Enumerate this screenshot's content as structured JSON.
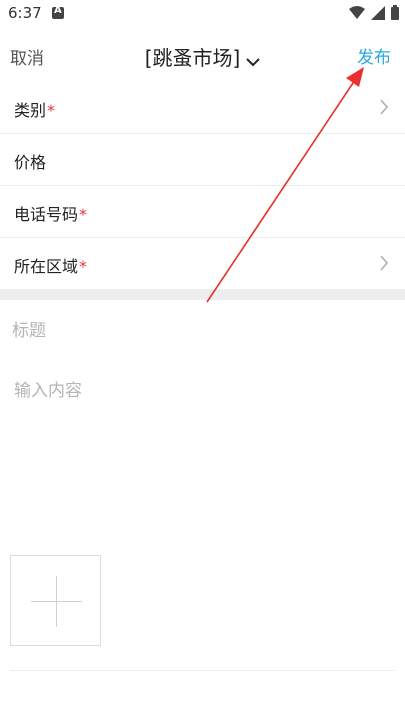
{
  "status_bar": {
    "time": "6:37",
    "notification_icon": "a-badge-icon",
    "icons": [
      "wifi-icon",
      "signal-icon",
      "battery-icon"
    ]
  },
  "header": {
    "cancel_label": "取消",
    "title": "[跳蚤市场]",
    "title_dropdown_icon": "chevron-down-icon",
    "publish_label": "发布",
    "publish_color": "#29a9e0"
  },
  "form": {
    "rows": [
      {
        "label": "类别",
        "required": "*",
        "has_arrow": true
      },
      {
        "label": "价格",
        "required": "",
        "has_arrow": false
      },
      {
        "label": "电话号码",
        "required": "*",
        "has_arrow": false
      },
      {
        "label": "所在区域",
        "required": "*",
        "has_arrow": true
      }
    ],
    "required_color": "#e53935"
  },
  "post": {
    "title_placeholder": "标题",
    "content_placeholder": "输入内容"
  },
  "annotation": {
    "color": "#e8312f"
  }
}
